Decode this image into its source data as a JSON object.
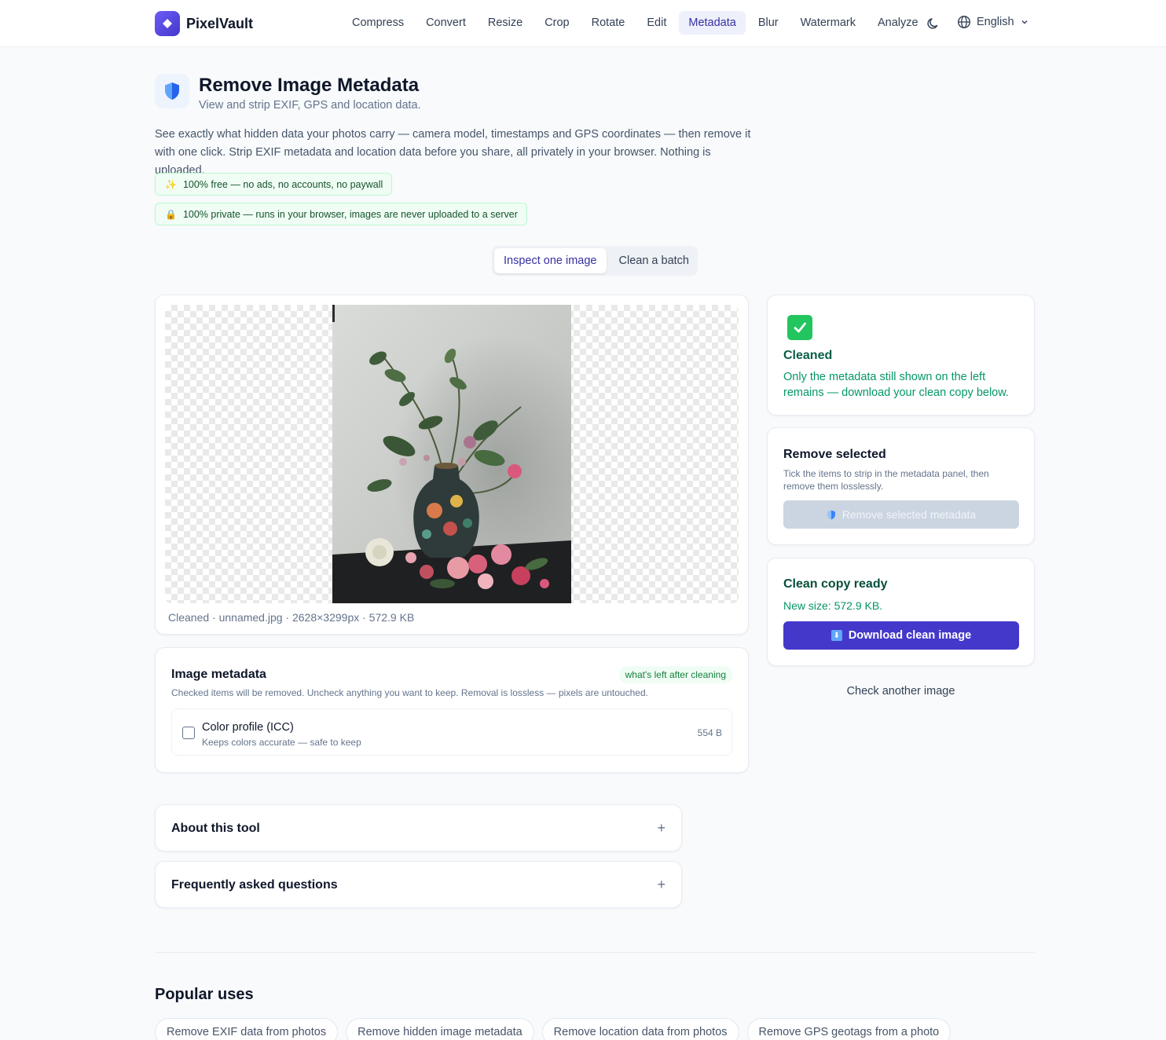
{
  "header": {
    "logo_text": "PixelVault",
    "nav": [
      {
        "label": "Compress"
      },
      {
        "label": "Convert"
      },
      {
        "label": "Resize"
      },
      {
        "label": "Crop"
      },
      {
        "label": "Rotate"
      },
      {
        "label": "Edit"
      },
      {
        "label": "Metadata",
        "active": true
      },
      {
        "label": "Blur"
      },
      {
        "label": "Watermark"
      },
      {
        "label": "Analyze"
      }
    ],
    "language": "English"
  },
  "hero": {
    "title": "Remove Image Metadata",
    "subtitle": "View and strip EXIF, GPS and location data.",
    "intro": "See exactly what hidden data your photos carry — camera model, timestamps and GPS coordinates — then remove it with one click. Strip EXIF metadata and location data before you share, all privately in your browser. Nothing is uploaded.",
    "pills": [
      {
        "icon": "sparkle-icon",
        "text": "100% free — no ads, no accounts, no paywall"
      },
      {
        "icon": "lock-icon",
        "text": "100% private — runs in your browser, images are never uploaded to a server"
      }
    ]
  },
  "tabs": [
    {
      "label": "Inspect one image",
      "active": true
    },
    {
      "label": "Clean a batch"
    }
  ],
  "preview": {
    "caption": "Cleaned · unnamed.jpg · 2628×3299px · 572.9 KB"
  },
  "metadata": {
    "title": "Image metadata",
    "badge": "what's left after cleaning",
    "description": "Checked items will be removed. Uncheck anything you want to keep. Removal is lossless — pixels are untouched.",
    "items": [
      {
        "label": "Color profile (ICC)",
        "sub": "Keeps colors accurate — safe to keep",
        "size": "554 B",
        "checked": false
      }
    ]
  },
  "status": {
    "title": "Cleaned",
    "text": "Only the metadata still shown on the left remains — download your clean copy below."
  },
  "remove": {
    "title": "Remove selected",
    "text": "Tick the items to strip in the metadata panel, then remove them losslessly.",
    "button": "Remove selected metadata"
  },
  "ready": {
    "title": "Clean copy ready",
    "text": "New size: 572.9 KB.",
    "button": "Download clean image",
    "secondary": "Check another image"
  },
  "accordions": [
    {
      "title": "About this tool"
    },
    {
      "title": "Frequently asked questions"
    }
  ],
  "popular": {
    "title": "Popular uses",
    "chips": [
      "Remove EXIF data from photos",
      "Remove hidden image metadata",
      "Remove location data from photos",
      "Remove GPS geotags from a photo"
    ]
  },
  "colors": {
    "accent": "#4338ca",
    "success": "#22c55e",
    "background": "#f8fafc"
  }
}
